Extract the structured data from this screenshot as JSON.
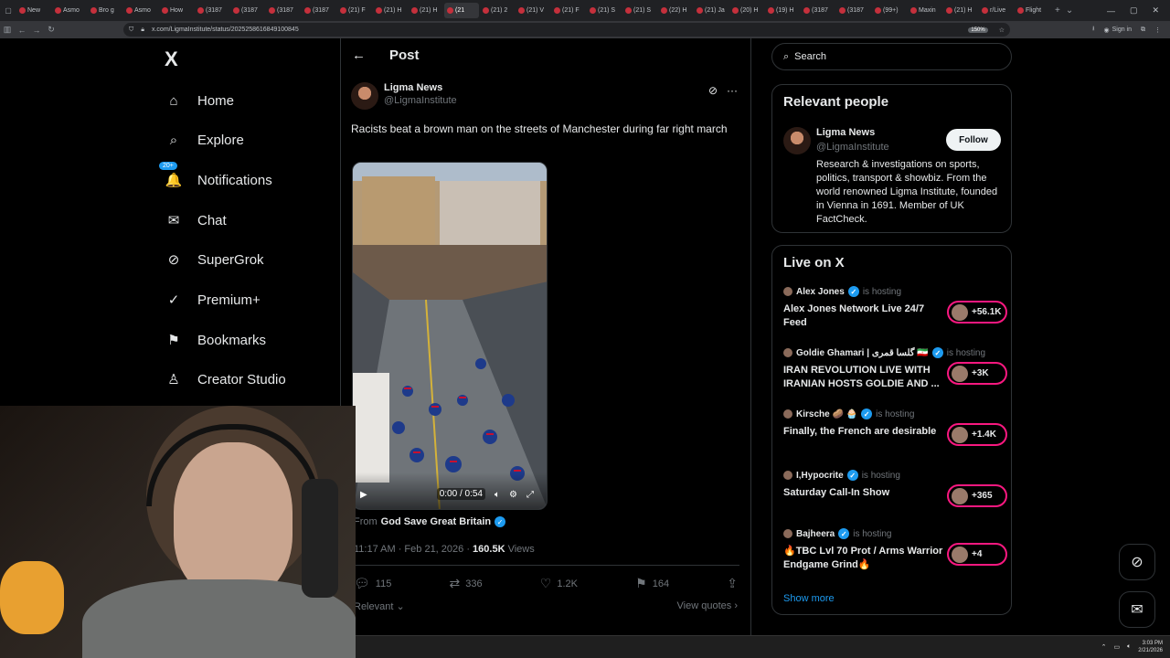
{
  "browser": {
    "tabs": [
      {
        "label": "New",
        "active": false
      },
      {
        "label": "Asmo",
        "active": false
      },
      {
        "label": "Bro g",
        "active": false
      },
      {
        "label": "Asmo",
        "active": false
      },
      {
        "label": "How",
        "active": false
      },
      {
        "label": "(3187",
        "active": false
      },
      {
        "label": "(3187",
        "active": false
      },
      {
        "label": "(3187",
        "active": false
      },
      {
        "label": "(3187",
        "active": false
      },
      {
        "label": "(21) F",
        "active": false
      },
      {
        "label": "(21) H",
        "active": false
      },
      {
        "label": "(21) H",
        "active": false
      },
      {
        "label": "(21",
        "active": true
      },
      {
        "label": "(21) 2",
        "active": false
      },
      {
        "label": "(21) V",
        "active": false
      },
      {
        "label": "(21) F",
        "active": false
      },
      {
        "label": "(21) S",
        "active": false
      },
      {
        "label": "(21) S",
        "active": false
      },
      {
        "label": "(22) H",
        "active": false
      },
      {
        "label": "(21) Ja",
        "active": false
      },
      {
        "label": "(20) H",
        "active": false
      },
      {
        "label": "(19) H",
        "active": false
      },
      {
        "label": "(3187",
        "active": false
      },
      {
        "label": "(3187",
        "active": false
      },
      {
        "label": "(99+)",
        "active": false
      },
      {
        "label": "Maxin",
        "active": false
      },
      {
        "label": "(21) H",
        "active": false
      },
      {
        "label": "r/Live",
        "active": false
      },
      {
        "label": "Flight",
        "active": false
      }
    ],
    "url": "x.com/LigmaInstitute/status/2025258616849100845",
    "zoom": "150%",
    "sign_in": "Sign in"
  },
  "nav": {
    "logo": "X",
    "items": [
      {
        "label": "Home",
        "icon": "home-icon",
        "glyph": "⌂"
      },
      {
        "label": "Explore",
        "icon": "search-icon",
        "glyph": "⌕"
      },
      {
        "label": "Notifications",
        "icon": "bell-icon",
        "glyph": "🔔",
        "badge": "20+"
      },
      {
        "label": "Chat",
        "icon": "mail-icon",
        "glyph": "✉"
      },
      {
        "label": "SuperGrok",
        "icon": "grok-icon",
        "glyph": "⊘"
      },
      {
        "label": "Premium+",
        "icon": "verified-icon",
        "glyph": "✓"
      },
      {
        "label": "Bookmarks",
        "icon": "bookmark-icon",
        "glyph": "⚑"
      },
      {
        "label": "Creator Studio",
        "icon": "creator-icon",
        "glyph": "♙"
      }
    ]
  },
  "post": {
    "header": "Post",
    "author_name": "Ligma News",
    "author_handle": "@LigmaInstitute",
    "text": "Racists beat a brown man on the streets of Manchester during far right march",
    "video_time": "0:00 / 0:54",
    "from_label": "From",
    "from_source": "God Save Great Britain",
    "timestamp": "11:17 AM · Feb 21, 2026 ·",
    "views_count": "160.5K",
    "views_label": "Views",
    "replies": "115",
    "reposts": "336",
    "likes": "1.2K",
    "bookmarks": "164",
    "sort_label": "Relevant",
    "view_quotes": "View quotes"
  },
  "sidebar": {
    "search_placeholder": "Search",
    "relevant": {
      "title": "Relevant people",
      "name": "Ligma News",
      "handle": "@LigmaInstitute",
      "follow_label": "Follow",
      "bio": "Research & investigations on sports, politics, transport & showbiz. From the world renowned Ligma Institute, founded in Vienna in 1691. Member of UK FactCheck."
    },
    "live": {
      "title": "Live on X",
      "hosting_label": "is hosting",
      "items": [
        {
          "host": "Alex Jones",
          "title": "Alex Jones Network Live 24/7 Feed",
          "count": "+56.1K"
        },
        {
          "host": "Goldie Ghamari | گلسا قمری 🇮🇷",
          "title": "IRAN REVOLUTION LIVE WITH IRANIAN HOSTS GOLDIE AND ...",
          "count": "+3K"
        },
        {
          "host": "Kirsche 🥔 🧁",
          "title": "Finally, the French are desirable",
          "count": "+1.4K"
        },
        {
          "host": "I,Hypocrite",
          "title": "Saturday Call-In Show",
          "count": "+365"
        },
        {
          "host": "Bajheera",
          "title": "🔥TBC Lvl 70 Prot / Arms Warrior Endgame Grind🔥",
          "count": "+4"
        }
      ],
      "show_more": "Show more"
    }
  },
  "taskbar": {
    "time": "3:03 PM",
    "date": "2/21/2026"
  }
}
